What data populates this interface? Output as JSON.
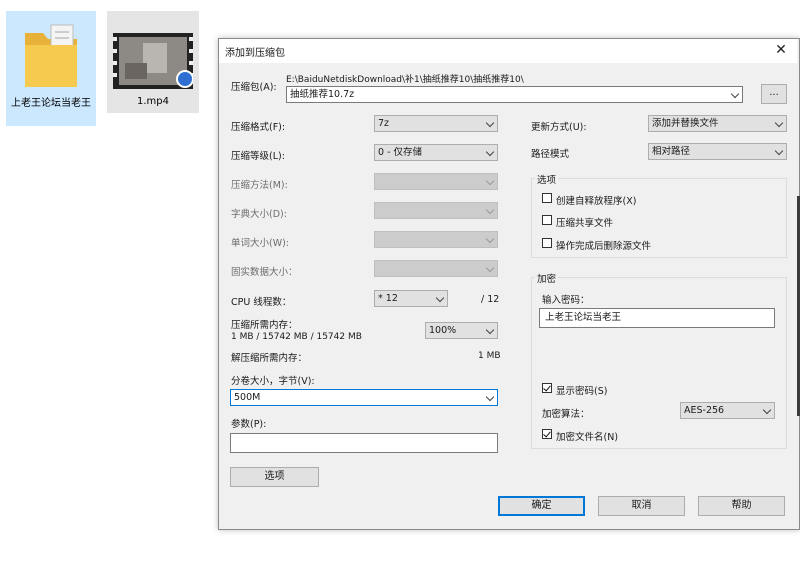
{
  "desktop": {
    "folder_label": "上老王论坛当老王",
    "video_label": "1.mp4"
  },
  "dialog": {
    "title": "添加到压缩包",
    "archive": {
      "label": "压缩包(A):",
      "path": "E:\\BaiduNetdiskDownload\\补1\\抽纸推荐10\\抽纸推荐10\\",
      "filename": "抽纸推荐10.7z",
      "browse_label": "..."
    },
    "left": {
      "format_label": "压缩格式(F):",
      "format_value": "7z",
      "level_label": "压缩等级(L):",
      "level_value": "0 - 仅存储",
      "method_label": "压缩方法(M):",
      "dict_label": "字典大小(D):",
      "word_label": "单词大小(W):",
      "solid_label": "固实数据大小：",
      "threads_label": "CPU 线程数：",
      "threads_value": "* 12",
      "threads_max": "/ 12",
      "mem_comp_label": "压缩所需内存：",
      "mem_comp_value": "1 MB / 15742 MB / 15742 MB",
      "mem_percent": "100%",
      "mem_decomp_label": "解压缩所需内存：",
      "mem_decomp_value": "1 MB",
      "split_label": "分卷大小，字节(V):",
      "split_value": "500M",
      "params_label": "参数(P):",
      "params_value": "",
      "options_button": "选项"
    },
    "right": {
      "update_label": "更新方式(U):",
      "update_value": "添加并替换文件",
      "path_label": "路径模式",
      "path_value": "相对路径",
      "options_group": "选项",
      "opt_sfx": "创建自释放程序(X)",
      "opt_shared": "压缩共享文件",
      "opt_delete": "操作完成后删除源文件",
      "encrypt_group": "加密",
      "password_label": "输入密码：",
      "password_value": "上老王论坛当老王",
      "show_password": "显示密码(S)",
      "method_label": "加密算法：",
      "method_value": "AES-256",
      "encrypt_names": "加密文件名(N)"
    },
    "buttons": {
      "ok": "确定",
      "cancel": "取消",
      "help": "帮助"
    }
  }
}
